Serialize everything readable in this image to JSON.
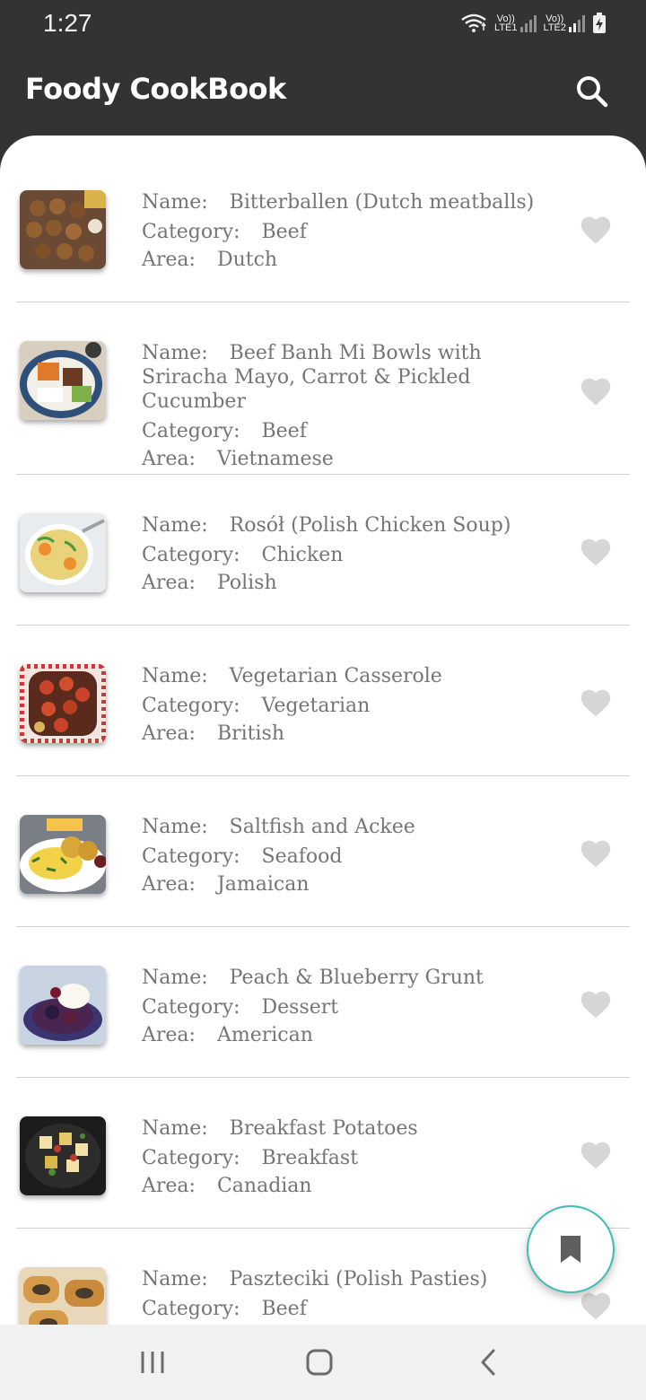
{
  "status_bar": {
    "time": "1:27",
    "sim1": {
      "top": "Vo))",
      "bottom": "LTE1"
    },
    "sim2": {
      "top": "Vo))",
      "bottom": "LTE2"
    }
  },
  "app_bar": {
    "title": "Foody CookBook"
  },
  "labels": {
    "name": "Name:",
    "category": "Category:",
    "area": "Area:"
  },
  "meals": [
    {
      "name_lines": [
        "Bitterballen (Dutch meatballs)"
      ],
      "category": "Beef",
      "area": "Dutch",
      "favorite": false
    },
    {
      "name_lines": [
        "Beef Banh Mi Bowls with",
        "Sriracha Mayo, Carrot & Pickled",
        "Cucumber"
      ],
      "category": "Beef",
      "area": "Vietnamese",
      "favorite": false
    },
    {
      "name_lines": [
        "Rosół (Polish Chicken Soup)"
      ],
      "category": "Chicken",
      "area": "Polish",
      "favorite": false
    },
    {
      "name_lines": [
        "Vegetarian Casserole"
      ],
      "category": "Vegetarian",
      "area": "British",
      "favorite": false
    },
    {
      "name_lines": [
        "Saltfish and Ackee"
      ],
      "category": "Seafood",
      "area": "Jamaican",
      "favorite": false
    },
    {
      "name_lines": [
        "Peach & Blueberry Grunt"
      ],
      "category": "Dessert",
      "area": "American",
      "favorite": false
    },
    {
      "name_lines": [
        "Breakfast Potatoes"
      ],
      "category": "Breakfast",
      "area": "Canadian",
      "favorite": false
    },
    {
      "name_lines": [
        "Paszteciki (Polish Pasties)"
      ],
      "category": "Beef",
      "area": "",
      "favorite": false
    }
  ],
  "colors": {
    "app_bar": "#333333",
    "text_secondary": "#757575",
    "heart_inactive": "#d6d6d6",
    "fab_border": "#3dbdb3",
    "nav_bar": "#f1f1f1"
  },
  "icons": {
    "search": "search-icon",
    "favorite": "heart-icon",
    "fab": "bookmark-icon",
    "nav_recents": "recents-icon",
    "nav_home": "home-icon",
    "nav_back": "back-icon"
  }
}
